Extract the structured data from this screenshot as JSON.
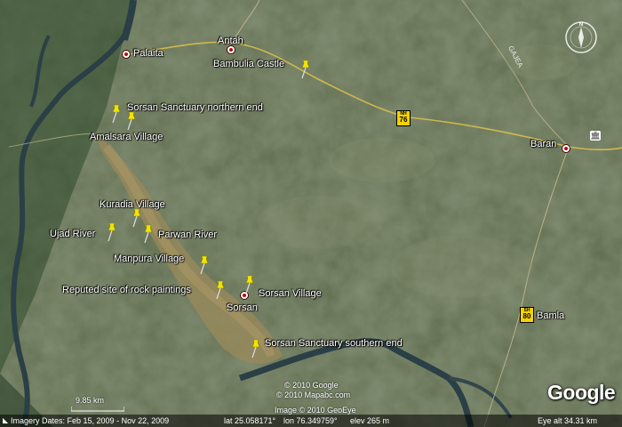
{
  "labels": {
    "palaita": "Palaita",
    "antah": "Antah",
    "bambulia": "Bambulia Castle",
    "sorsan_north": "Sorsan Sanctuary northern end",
    "amalsara": "Amalsara Village",
    "baran": "Baran",
    "kuradia": "Kuradia Village",
    "ujad": "Ujad River",
    "parwan": "Parwan River",
    "manpura": "Manpura Village",
    "rock_paintings": "Reputed site of rock paintings",
    "sorsan_village": "Sorsan Village",
    "sorsan": "Sorsan",
    "bamla": "Bamla",
    "sorsan_south": "Sorsan Sanctuary southern end"
  },
  "shields": {
    "nh76": {
      "top": "NH",
      "num": "76"
    },
    "sh80": {
      "top": "SH",
      "num": "80"
    }
  },
  "road_label": "GAJEA",
  "compass_north": "N",
  "credits": {
    "c1": "© 2010 Google",
    "c2": "© 2010 Mapabc.com",
    "c3": "Image © 2010 GeoEye"
  },
  "scale_text": "9.85 km",
  "status": {
    "imagery_dates": "Imagery Dates: Feb 15, 2009 - Nov 22, 2009",
    "lat": "lat   25.058171°",
    "lon": "lon   76.349759°",
    "elev": "elev  265 m",
    "eye_alt": "Eye alt    34.31 km"
  },
  "logo": "Google",
  "colors": {
    "pin": "#f2e600",
    "river": "#2b3f46",
    "highway": "#e0c24a"
  },
  "icons": {
    "pin": "push-pin-icon",
    "town": "town-marker-icon",
    "landmark": "landmark-building-icon",
    "compass": "compass-icon"
  }
}
